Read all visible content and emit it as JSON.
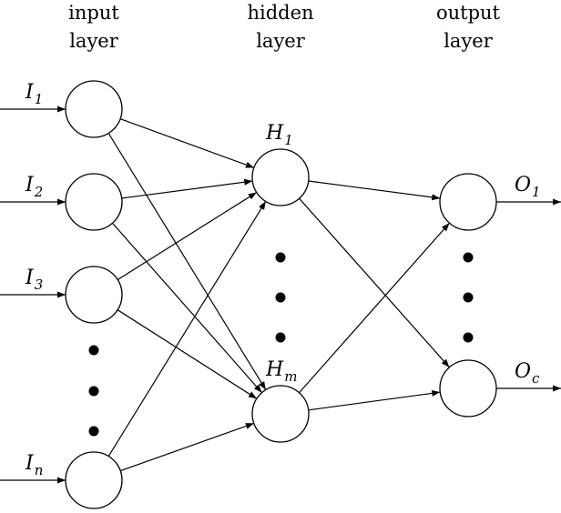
{
  "layers": [
    {
      "title_line1": "input",
      "title_line2": "layer",
      "nodes": [
        {
          "main": "I",
          "sub": "1"
        },
        {
          "main": "I",
          "sub": "2"
        },
        {
          "main": "I",
          "sub": "3"
        },
        {
          "main": "I",
          "sub": "n"
        }
      ]
    },
    {
      "title_line1": "hidden",
      "title_line2": "layer",
      "nodes": [
        {
          "main": "H",
          "sub": "1"
        },
        {
          "main": "H",
          "sub": "m"
        }
      ]
    },
    {
      "title_line1": "output",
      "title_line2": "layer",
      "nodes": [
        {
          "main": "O",
          "sub": "1"
        },
        {
          "main": "O",
          "sub": "c"
        }
      ]
    }
  ],
  "connectivity": "fully-connected",
  "colors": {
    "stroke": "#000000",
    "background": "#ffffff"
  }
}
